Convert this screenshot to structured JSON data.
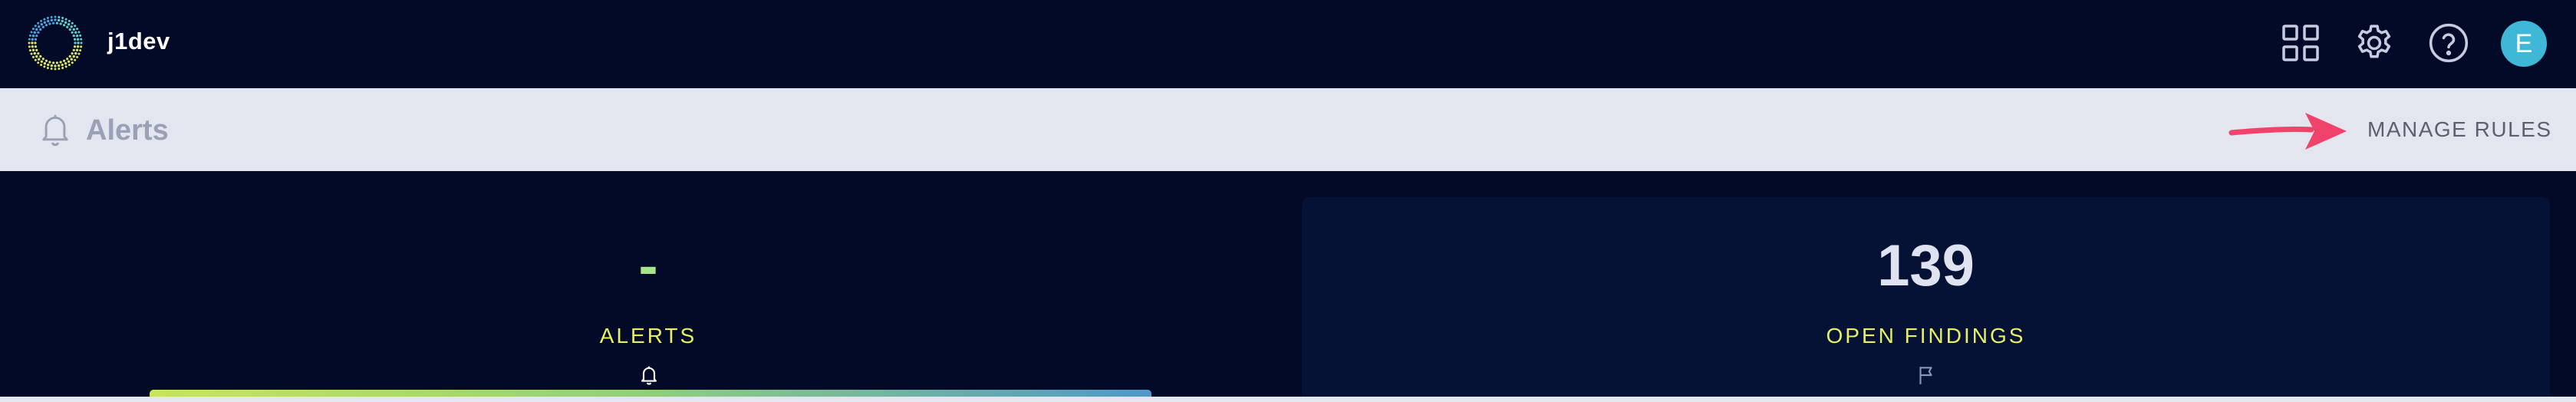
{
  "header": {
    "app_name": "j1dev",
    "icons": [
      "grid-icon",
      "gear-icon",
      "help-icon"
    ],
    "avatar_initial": "E",
    "avatar_color": "#3fb8d8"
  },
  "subheader": {
    "title": "Alerts",
    "manage_rules_label": "MANAGE RULES",
    "arrow_color": "#f0426a"
  },
  "metrics": [
    {
      "value": "-",
      "label": "ALERTS",
      "icon": "bell-icon"
    },
    {
      "value": "139",
      "label": "OPEN FINDINGS",
      "icon": "flag-icon"
    }
  ],
  "colors": {
    "background": "#030a28",
    "subheader_bg": "#e3e5ef",
    "label_accent": "#e7ef63",
    "alert_value": "#a8e28a"
  }
}
